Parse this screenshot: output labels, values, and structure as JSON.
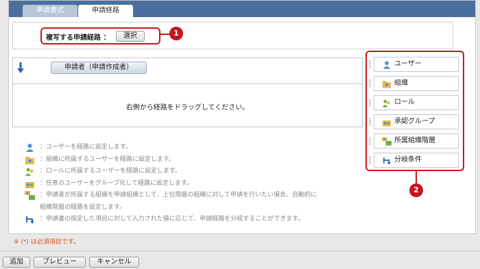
{
  "tabs": [
    {
      "label": "申請書式",
      "active": false
    },
    {
      "label": "申請経路",
      "active": true
    }
  ],
  "copy_route": {
    "label": "複写する申請経路 ：",
    "select_button": "選択"
  },
  "callouts": [
    "1",
    "2"
  ],
  "route": {
    "applicant_label": "申請者（申請作成者）",
    "drag_hint": "右側から経路をドラッグしてください。"
  },
  "legend": [
    {
      "icon": "user-icon",
      "text": "：ユーザーを経路に設定します。"
    },
    {
      "icon": "organization-icon",
      "text": "：組織に所属するユーザーを経路に設定します。"
    },
    {
      "icon": "role-icon",
      "text": "：ロールに所属するユーザーを経路に設定します。"
    },
    {
      "icon": "approval-group-icon",
      "text": "：任意のユーザーをグループ化して経路に設定します。"
    },
    {
      "icon": "org-hierarchy-icon",
      "text": "：申請者が所属する組織を申請組織として、上位階層の組織に対して申請を行いたい場合、自動的に"
    },
    {
      "icon": "",
      "text": "組織階層の経路を設定します。"
    },
    {
      "icon": "branch-icon",
      "text": "：申請書の指定した項目に対して入力された値に応じて、申請経路を分岐することができます。"
    }
  ],
  "palette": [
    {
      "icon": "user-icon",
      "label": "ユーザー"
    },
    {
      "icon": "organization-icon",
      "label": "組織"
    },
    {
      "icon": "role-icon",
      "label": "ロール"
    },
    {
      "icon": "approval-group-icon",
      "label": "承認グループ"
    },
    {
      "icon": "org-hierarchy-icon",
      "label": "所属組織階層"
    },
    {
      "icon": "branch-icon",
      "label": "分岐条件"
    }
  ],
  "required_note": "※ (*) は必須項目です。",
  "footer": {
    "add": "追加",
    "preview": "プレビュー",
    "cancel": "キャンセル"
  },
  "colors": {
    "header": "#4a6f9e",
    "callout": "#c4161c",
    "required": "#d9531e"
  }
}
